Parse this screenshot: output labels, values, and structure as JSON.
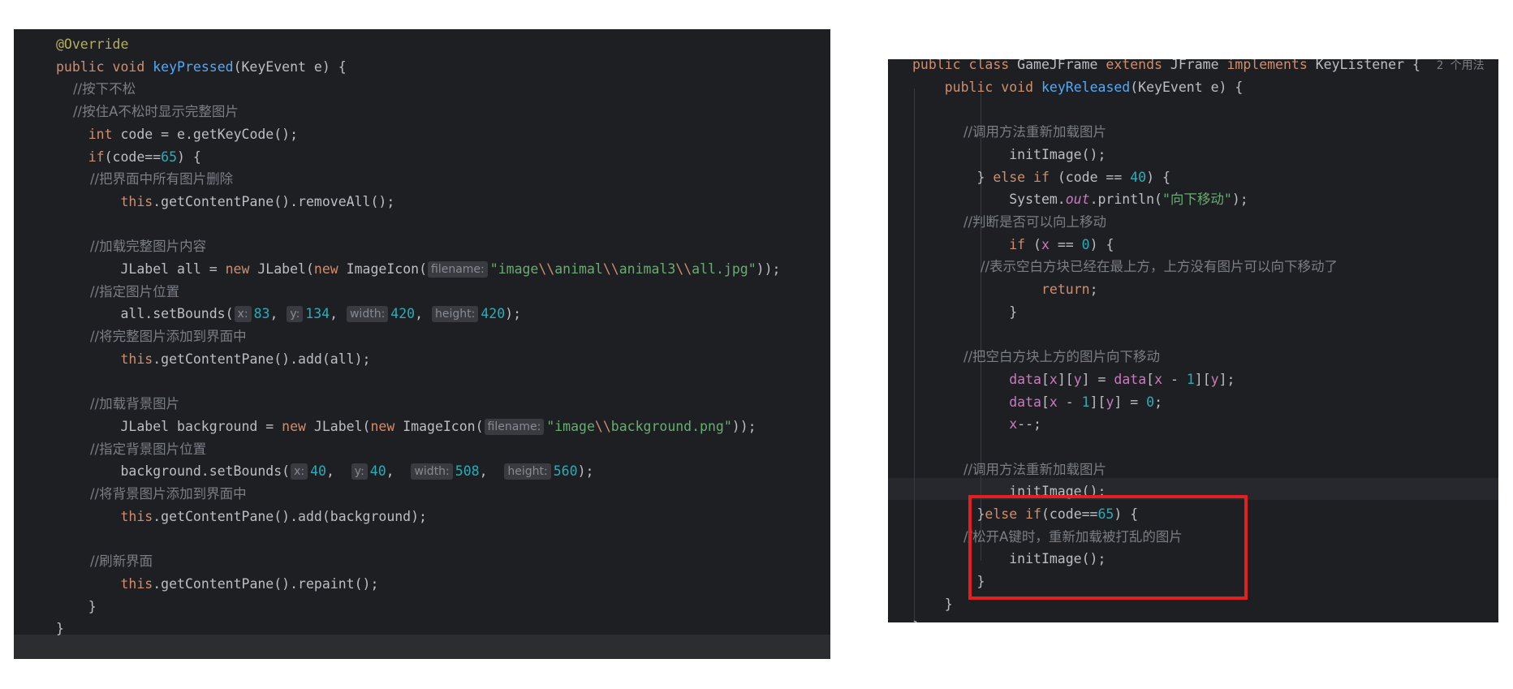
{
  "left_panel": {
    "lines": [
      {
        "segs": [
          {
            "t": "@Override",
            "c": "ann"
          }
        ]
      },
      {
        "segs": [
          {
            "t": "public void ",
            "c": "kw"
          },
          {
            "t": "keyPressed",
            "c": "fn"
          },
          {
            "t": "(KeyEvent e) {",
            "c": "pl"
          }
        ]
      },
      {
        "segs": [
          {
            "t": "    //按下不松",
            "c": "cmt"
          }
        ]
      },
      {
        "segs": [
          {
            "t": "    //按住A不松时显示完整图片",
            "c": "cmt"
          }
        ]
      },
      {
        "segs": [
          {
            "t": "    ",
            "c": "pl"
          },
          {
            "t": "int ",
            "c": "kw"
          },
          {
            "t": "code = e.getKeyCode();",
            "c": "pl"
          }
        ]
      },
      {
        "segs": [
          {
            "t": "    ",
            "c": "pl"
          },
          {
            "t": "if",
            "c": "kw"
          },
          {
            "t": "(code==",
            "c": "pl"
          },
          {
            "t": "65",
            "c": "num"
          },
          {
            "t": ") {",
            "c": "pl"
          }
        ]
      },
      {
        "segs": [
          {
            "t": "        //把界面中所有图片删除",
            "c": "cmt"
          }
        ]
      },
      {
        "segs": [
          {
            "t": "        ",
            "c": "pl"
          },
          {
            "t": "this",
            "c": "kw"
          },
          {
            "t": ".getContentPane().removeAll();",
            "c": "pl"
          }
        ]
      },
      {
        "segs": []
      },
      {
        "segs": [
          {
            "t": "        //加载完整图片内容",
            "c": "cmt"
          }
        ]
      },
      {
        "segs": [
          {
            "t": "        JLabel all = ",
            "c": "pl"
          },
          {
            "t": "new ",
            "c": "kw"
          },
          {
            "t": "JLabel(",
            "c": "pl"
          },
          {
            "t": "new ",
            "c": "kw"
          },
          {
            "t": "ImageIcon(",
            "c": "pl"
          },
          {
            "h": "filename:"
          },
          {
            "t": "\"image",
            "c": "str"
          },
          {
            "t": "\\\\",
            "c": "kw"
          },
          {
            "t": "animal",
            "c": "str"
          },
          {
            "t": "\\\\",
            "c": "kw"
          },
          {
            "t": "animal3",
            "c": "str"
          },
          {
            "t": "\\\\",
            "c": "kw"
          },
          {
            "t": "all.jpg\"",
            "c": "str"
          },
          {
            "t": "));",
            "c": "pl"
          }
        ]
      },
      {
        "segs": [
          {
            "t": "        //指定图片位置",
            "c": "cmt"
          }
        ]
      },
      {
        "segs": [
          {
            "t": "        all.setBounds(",
            "c": "pl"
          },
          {
            "h": "x:"
          },
          {
            "t": "83",
            "c": "num"
          },
          {
            "t": ", ",
            "c": "pl"
          },
          {
            "h": "y:"
          },
          {
            "t": "134",
            "c": "num"
          },
          {
            "t": ", ",
            "c": "pl"
          },
          {
            "h": "width:"
          },
          {
            "t": "420",
            "c": "num"
          },
          {
            "t": ", ",
            "c": "pl"
          },
          {
            "h": "height:"
          },
          {
            "t": "420",
            "c": "num"
          },
          {
            "t": ");",
            "c": "pl"
          }
        ]
      },
      {
        "segs": [
          {
            "t": "        //将完整图片添加到界面中",
            "c": "cmt"
          }
        ]
      },
      {
        "segs": [
          {
            "t": "        ",
            "c": "pl"
          },
          {
            "t": "this",
            "c": "kw"
          },
          {
            "t": ".getContentPane().add(all);",
            "c": "pl"
          }
        ]
      },
      {
        "segs": []
      },
      {
        "segs": [
          {
            "t": "        //加载背景图片",
            "c": "cmt"
          }
        ]
      },
      {
        "segs": [
          {
            "t": "        JLabel background = ",
            "c": "pl"
          },
          {
            "t": "new ",
            "c": "kw"
          },
          {
            "t": "JLabel(",
            "c": "pl"
          },
          {
            "t": "new ",
            "c": "kw"
          },
          {
            "t": "ImageIcon(",
            "c": "pl"
          },
          {
            "h": "filename:"
          },
          {
            "t": "\"image",
            "c": "str"
          },
          {
            "t": "\\\\",
            "c": "kw"
          },
          {
            "t": "background.png\"",
            "c": "str"
          },
          {
            "t": "));",
            "c": "pl"
          }
        ]
      },
      {
        "segs": [
          {
            "t": "        //指定背景图片位置",
            "c": "cmt"
          }
        ]
      },
      {
        "segs": [
          {
            "t": "        background.setBounds(",
            "c": "pl"
          },
          {
            "h": "x:"
          },
          {
            "t": "40",
            "c": "num"
          },
          {
            "t": ",  ",
            "c": "pl"
          },
          {
            "h": "y:"
          },
          {
            "t": "40",
            "c": "num"
          },
          {
            "t": ",  ",
            "c": "pl"
          },
          {
            "h": "width:"
          },
          {
            "t": "508",
            "c": "num"
          },
          {
            "t": ",  ",
            "c": "pl"
          },
          {
            "h": "height:"
          },
          {
            "t": "560",
            "c": "num"
          },
          {
            "t": ");",
            "c": "pl"
          }
        ]
      },
      {
        "segs": [
          {
            "t": "        //将背景图片添加到界面中",
            "c": "cmt"
          }
        ]
      },
      {
        "segs": [
          {
            "t": "        ",
            "c": "pl"
          },
          {
            "t": "this",
            "c": "kw"
          },
          {
            "t": ".getContentPane().add(background);",
            "c": "pl"
          }
        ]
      },
      {
        "segs": []
      },
      {
        "segs": [
          {
            "t": "        //刷新界面",
            "c": "cmt"
          }
        ]
      },
      {
        "segs": [
          {
            "t": "        ",
            "c": "pl"
          },
          {
            "t": "this",
            "c": "kw"
          },
          {
            "t": ".getContentPane().repaint();",
            "c": "pl"
          }
        ]
      },
      {
        "segs": [
          {
            "t": "    }",
            "c": "pl"
          }
        ]
      },
      {
        "segs": [
          {
            "t": "}",
            "c": "pl"
          }
        ]
      }
    ]
  },
  "right_panel": {
    "lines": [
      {
        "segs": [
          {
            "t": "public class ",
            "c": "kw"
          },
          {
            "t": "GameJFrame ",
            "c": "pl"
          },
          {
            "t": "extends ",
            "c": "kw"
          },
          {
            "t": "JFrame ",
            "c": "pl"
          },
          {
            "t": "implements ",
            "c": "kw"
          },
          {
            "t": "KeyListener {  ",
            "c": "pl"
          },
          {
            "t": "2 个用法",
            "c": "hint"
          }
        ]
      },
      {
        "segs": [
          {
            "t": "    ",
            "c": "pl"
          },
          {
            "t": "public void ",
            "c": "kw"
          },
          {
            "t": "keyReleased",
            "c": "fn"
          },
          {
            "t": "(KeyEvent e) {",
            "c": "pl"
          }
        ]
      },
      {
        "segs": []
      },
      {
        "segs": [
          {
            "t": "            //调用方法重新加载图片",
            "c": "cmt"
          }
        ]
      },
      {
        "segs": [
          {
            "t": "            initImage();",
            "c": "pl"
          }
        ]
      },
      {
        "segs": [
          {
            "t": "        } ",
            "c": "pl"
          },
          {
            "t": "else if ",
            "c": "kw"
          },
          {
            "t": "(code == ",
            "c": "pl"
          },
          {
            "t": "40",
            "c": "num"
          },
          {
            "t": ") {",
            "c": "pl"
          }
        ]
      },
      {
        "segs": [
          {
            "t": "            System.",
            "c": "pl"
          },
          {
            "t": "out",
            "c": "out"
          },
          {
            "t": ".println(",
            "c": "pl"
          },
          {
            "t": "\"向下移动\"",
            "c": "str"
          },
          {
            "t": ");",
            "c": "pl"
          }
        ]
      },
      {
        "segs": [
          {
            "t": "            //判断是否可以向上移动",
            "c": "cmt"
          }
        ]
      },
      {
        "segs": [
          {
            "t": "            ",
            "c": "pl"
          },
          {
            "t": "if ",
            "c": "kw"
          },
          {
            "t": "(",
            "c": "pl"
          },
          {
            "t": "x",
            "c": "fld"
          },
          {
            "t": " == ",
            "c": "pl"
          },
          {
            "t": "0",
            "c": "num"
          },
          {
            "t": ") {",
            "c": "pl"
          }
        ]
      },
      {
        "segs": [
          {
            "t": "                //表示空白方块已经在最上方，上方没有图片可以向下移动了",
            "c": "cmt"
          }
        ]
      },
      {
        "segs": [
          {
            "t": "                ",
            "c": "pl"
          },
          {
            "t": "return",
            "c": "kw"
          },
          {
            "t": ";",
            "c": "pl"
          }
        ]
      },
      {
        "segs": [
          {
            "t": "            }",
            "c": "pl"
          }
        ]
      },
      {
        "segs": []
      },
      {
        "segs": [
          {
            "t": "            //把空白方块上方的图片向下移动",
            "c": "cmt"
          }
        ]
      },
      {
        "segs": [
          {
            "t": "            ",
            "c": "pl"
          },
          {
            "t": "data",
            "c": "fld"
          },
          {
            "t": "[",
            "c": "pl"
          },
          {
            "t": "x",
            "c": "fld"
          },
          {
            "t": "][",
            "c": "pl"
          },
          {
            "t": "y",
            "c": "fld"
          },
          {
            "t": "] = ",
            "c": "pl"
          },
          {
            "t": "data",
            "c": "fld"
          },
          {
            "t": "[",
            "c": "pl"
          },
          {
            "t": "x",
            "c": "fld"
          },
          {
            "t": " - ",
            "c": "pl"
          },
          {
            "t": "1",
            "c": "num"
          },
          {
            "t": "][",
            "c": "pl"
          },
          {
            "t": "y",
            "c": "fld"
          },
          {
            "t": "];",
            "c": "pl"
          }
        ]
      },
      {
        "segs": [
          {
            "t": "            ",
            "c": "pl"
          },
          {
            "t": "data",
            "c": "fld"
          },
          {
            "t": "[",
            "c": "pl"
          },
          {
            "t": "x",
            "c": "fld"
          },
          {
            "t": " - ",
            "c": "pl"
          },
          {
            "t": "1",
            "c": "num"
          },
          {
            "t": "][",
            "c": "pl"
          },
          {
            "t": "y",
            "c": "fld"
          },
          {
            "t": "] = ",
            "c": "pl"
          },
          {
            "t": "0",
            "c": "num"
          },
          {
            "t": ";",
            "c": "pl"
          }
        ]
      },
      {
        "segs": [
          {
            "t": "            ",
            "c": "pl"
          },
          {
            "t": "x",
            "c": "fld"
          },
          {
            "t": "--;",
            "c": "pl"
          }
        ]
      },
      {
        "segs": []
      },
      {
        "segs": [
          {
            "t": "            //调用方法重新加载图片",
            "c": "cmt"
          }
        ]
      },
      {
        "segs": [
          {
            "t": "            initImage();",
            "c": "pl"
          }
        ]
      },
      {
        "segs": [
          {
            "t": "        }",
            "c": "pl"
          },
          {
            "t": "else if",
            "c": "kw"
          },
          {
            "t": "(code==",
            "c": "pl"
          },
          {
            "t": "65",
            "c": "num"
          },
          {
            "t": ") {",
            "c": "pl"
          }
        ]
      },
      {
        "segs": [
          {
            "t": "            //松开A键时，重新加载被打乱的图片",
            "c": "cmt"
          }
        ]
      },
      {
        "segs": [
          {
            "t": "            initImage();",
            "c": "pl"
          }
        ]
      },
      {
        "segs": [
          {
            "t": "        }",
            "c": "pl"
          }
        ]
      },
      {
        "segs": [
          {
            "t": "    }",
            "c": "pl"
          }
        ]
      },
      {
        "segs": [
          {
            "t": "}",
            "c": "pl"
          }
        ]
      }
    ]
  },
  "colors": {
    "editor_bg": "#1e1f22",
    "highlight_border": "#e1201f"
  }
}
